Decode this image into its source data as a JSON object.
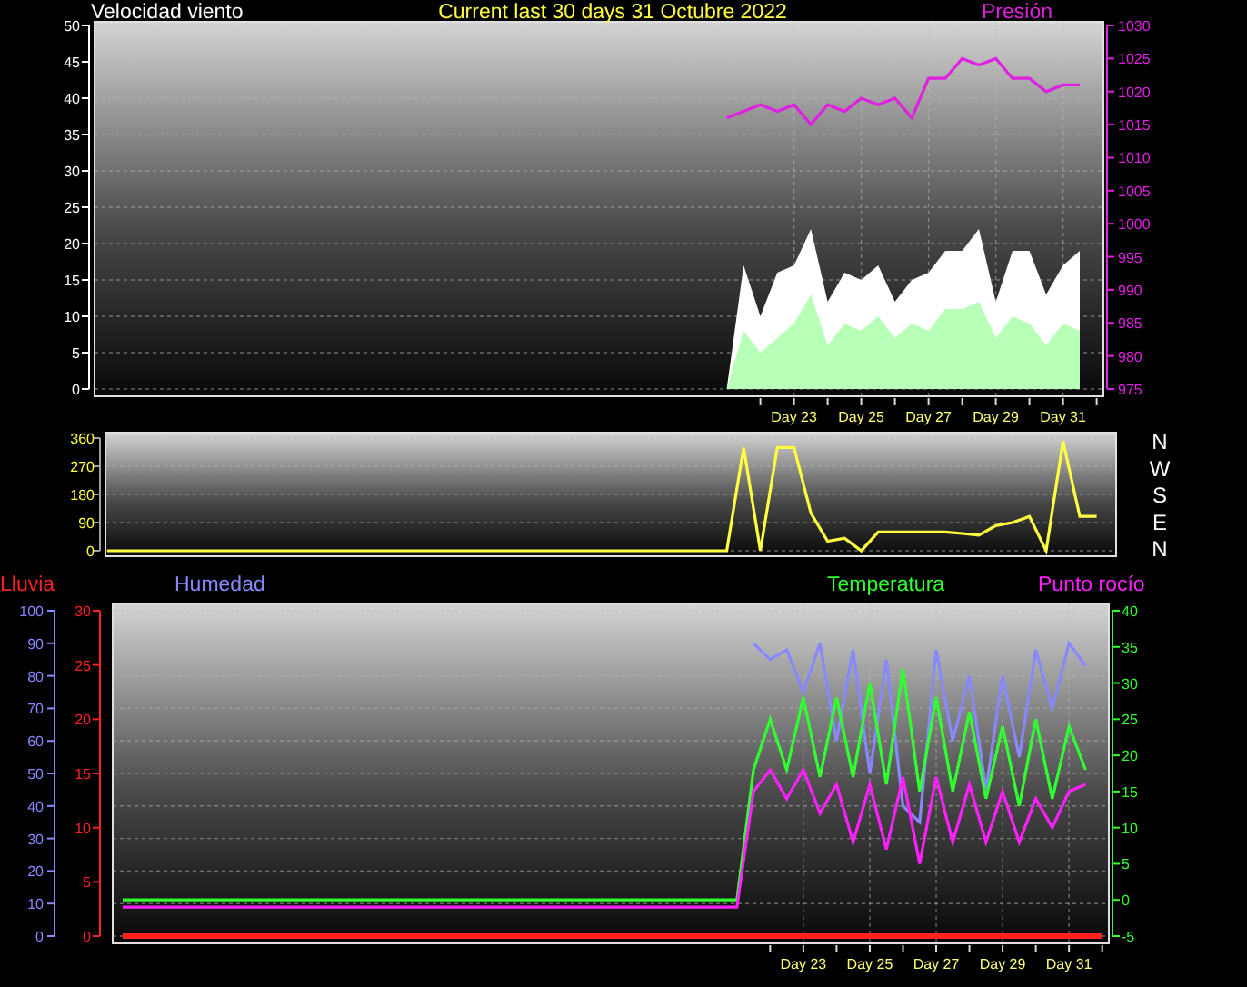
{
  "title": "Current last 30 days 31 Octubre 2022",
  "panels": [
    {
      "chart_data": {
        "type": "line",
        "categories": [
          null,
          null,
          null,
          null,
          null,
          null,
          null,
          null,
          null,
          null,
          null,
          null,
          null,
          null,
          null,
          null,
          null,
          null,
          null,
          null,
          null,
          null,
          null,
          null,
          null,
          null,
          null,
          null,
          null,
          null,
          null,
          null,
          null,
          null,
          null,
          null,
          null,
          null,
          null,
          null,
          null,
          "Day 23",
          null,
          null,
          null,
          "Day 25",
          null,
          null,
          null,
          "Day 27",
          null,
          null,
          null,
          "Day 29",
          null,
          null,
          null,
          "Day 31",
          null,
          null
        ],
        "grid": true,
        "ylim": [
          0,
          50
        ],
        "yticks": [
          0,
          5,
          10,
          15,
          20,
          25,
          30,
          35,
          40,
          45,
          50
        ],
        "y2lim": [
          975,
          1030
        ],
        "y2ticks": [
          975,
          980,
          985,
          990,
          995,
          1000,
          1005,
          1010,
          1015,
          1020,
          1025,
          1030
        ],
        "series": [
          {
            "name": "Velocidad viento",
            "type": "area",
            "color": "#ffffff",
            "values": [
              0,
              0,
              0,
              0,
              0,
              0,
              0,
              0,
              0,
              0,
              0,
              0,
              0,
              0,
              0,
              0,
              0,
              0,
              0,
              0,
              0,
              0,
              0,
              0,
              0,
              0,
              0,
              0,
              0,
              0,
              0,
              0,
              0,
              0,
              0,
              0,
              0,
              0,
              17,
              10,
              16,
              17,
              22,
              12,
              16,
              15,
              17,
              12,
              15,
              16,
              19,
              19,
              22,
              12,
              19,
              19,
              13,
              17,
              19,
              null
            ]
          },
          {
            "type": "area",
            "color": "#b8ffb8",
            "values": [
              0,
              0,
              0,
              0,
              0,
              0,
              0,
              0,
              0,
              0,
              0,
              0,
              0,
              0,
              0,
              0,
              0,
              0,
              0,
              0,
              0,
              0,
              0,
              0,
              0,
              0,
              0,
              0,
              0,
              0,
              0,
              0,
              0,
              0,
              0,
              0,
              0,
              0,
              8,
              5,
              7,
              9,
              13,
              6,
              9,
              8,
              10,
              7,
              9,
              8,
              11,
              11,
              12,
              7,
              10,
              9,
              6,
              9,
              8,
              null
            ]
          },
          {
            "name": "Presión",
            "type": "line",
            "axis": "y2",
            "color": "#e020e0",
            "values": [
              null,
              null,
              null,
              null,
              null,
              null,
              null,
              null,
              null,
              null,
              null,
              null,
              null,
              null,
              null,
              null,
              null,
              null,
              null,
              null,
              null,
              null,
              null,
              null,
              null,
              null,
              null,
              null,
              null,
              null,
              null,
              null,
              null,
              null,
              null,
              null,
              null,
              1016,
              1017,
              1018,
              1017,
              1018,
              1015,
              1018,
              1017,
              1019,
              1018,
              1019,
              1016,
              1022,
              1022,
              1025,
              1024,
              1025,
              1022,
              1022,
              1020,
              1021,
              1021,
              null
            ]
          }
        ]
      }
    },
    {
      "chart_data": {
        "type": "line",
        "categories": [
          null,
          null,
          null,
          null,
          null,
          null,
          null,
          null,
          null,
          null,
          null,
          null,
          null,
          null,
          null,
          null,
          null,
          null,
          null,
          null,
          null,
          null,
          null,
          null,
          null,
          null,
          null,
          null,
          null,
          null,
          null,
          null,
          null,
          null,
          null,
          null,
          null,
          null,
          null,
          null,
          null,
          null,
          null,
          null,
          null,
          null,
          null,
          null,
          null,
          null,
          null,
          null,
          null,
          null,
          null,
          null,
          null,
          null,
          null,
          null
        ],
        "ylim": [
          0,
          360
        ],
        "yticks": [
          0,
          90,
          180,
          270,
          360
        ],
        "grid": true,
        "series": [
          {
            "type": "line",
            "color": "#ffff40",
            "values": [
              0,
              0,
              0,
              0,
              0,
              0,
              0,
              0,
              0,
              0,
              0,
              0,
              0,
              0,
              0,
              0,
              0,
              0,
              0,
              0,
              0,
              0,
              0,
              0,
              0,
              0,
              0,
              0,
              0,
              0,
              0,
              0,
              0,
              0,
              0,
              0,
              0,
              0,
              330,
              0,
              330,
              330,
              120,
              30,
              40,
              0,
              60,
              60,
              60,
              60,
              60,
              55,
              50,
              80,
              90,
              110,
              0,
              350,
              110,
              110
            ]
          }
        ]
      },
      "compass_labels": [
        "N",
        "W",
        "S",
        "E",
        "N"
      ]
    },
    {
      "chart_data": {
        "type": "line",
        "categories": [
          null,
          null,
          null,
          null,
          null,
          null,
          null,
          null,
          null,
          null,
          null,
          null,
          null,
          null,
          null,
          null,
          null,
          null,
          null,
          null,
          null,
          null,
          null,
          null,
          null,
          null,
          null,
          null,
          null,
          null,
          null,
          null,
          null,
          null,
          null,
          null,
          null,
          null,
          null,
          null,
          null,
          "Day 23",
          null,
          null,
          null,
          "Day 25",
          null,
          null,
          null,
          "Day 27",
          null,
          null,
          null,
          "Day 29",
          null,
          null,
          null,
          "Day 31",
          null,
          null
        ],
        "grid": true,
        "ylim": [
          0,
          100
        ],
        "yticks": [
          0,
          10,
          20,
          30,
          40,
          50,
          60,
          70,
          80,
          90,
          100
        ],
        "y2lim": [
          0,
          30
        ],
        "y2ticks": [
          0,
          5,
          10,
          15,
          20,
          25,
          30
        ],
        "y3lim": [
          -5,
          40
        ],
        "y3ticks": [
          -5,
          0,
          5,
          10,
          15,
          20,
          25,
          30,
          35,
          40
        ],
        "series": [
          {
            "name": "Lluvia",
            "type": "line",
            "axis": "y2",
            "color": "#ff2020",
            "values": [
              0,
              0,
              0,
              0,
              0,
              0,
              0,
              0,
              0,
              0,
              0,
              0,
              0,
              0,
              0,
              0,
              0,
              0,
              0,
              0,
              0,
              0,
              0,
              0,
              0,
              0,
              0,
              0,
              0,
              0,
              0,
              0,
              0,
              0,
              0,
              0,
              0,
              0,
              0,
              0,
              0,
              0,
              0,
              0,
              0,
              0,
              0,
              0,
              0,
              0,
              0,
              0,
              0,
              0,
              0,
              0,
              0,
              0,
              0,
              0
            ]
          },
          {
            "name": "Humedad",
            "type": "line",
            "color": "#8888ff",
            "values": [
              null,
              null,
              null,
              null,
              null,
              null,
              null,
              null,
              null,
              null,
              null,
              null,
              null,
              null,
              null,
              null,
              null,
              null,
              null,
              null,
              null,
              null,
              null,
              null,
              null,
              null,
              null,
              null,
              null,
              null,
              null,
              null,
              null,
              null,
              null,
              null,
              null,
              null,
              90,
              85,
              88,
              75,
              90,
              60,
              88,
              50,
              85,
              40,
              35,
              88,
              60,
              80,
              45,
              80,
              55,
              88,
              70,
              90,
              83,
              null
            ]
          },
          {
            "name": "Temperatura",
            "type": "line",
            "axis": "y3",
            "color": "#30ff30",
            "values": [
              0,
              0,
              0,
              0,
              0,
              0,
              0,
              0,
              0,
              0,
              0,
              0,
              0,
              0,
              0,
              0,
              0,
              0,
              0,
              0,
              0,
              0,
              0,
              0,
              0,
              0,
              0,
              0,
              0,
              0,
              0,
              0,
              0,
              0,
              0,
              0,
              0,
              0,
              18,
              25,
              18,
              28,
              17,
              28,
              17,
              30,
              16,
              32,
              15,
              28,
              15,
              26,
              14,
              24,
              13,
              25,
              14,
              24,
              18,
              null
            ]
          },
          {
            "name": "Punto rocío",
            "type": "line",
            "axis": "y3",
            "color": "#ff20ff",
            "values": [
              -1,
              -1,
              -1,
              -1,
              -1,
              -1,
              -1,
              -1,
              -1,
              -1,
              -1,
              -1,
              -1,
              -1,
              -1,
              -1,
              -1,
              -1,
              -1,
              -1,
              -1,
              -1,
              -1,
              -1,
              -1,
              -1,
              -1,
              -1,
              -1,
              -1,
              -1,
              -1,
              -1,
              -1,
              -1,
              -1,
              -1,
              -1,
              15,
              18,
              14,
              18,
              12,
              16,
              8,
              16,
              7,
              17,
              5,
              17,
              8,
              16,
              8,
              15,
              8,
              14,
              10,
              15,
              16,
              null
            ]
          }
        ]
      }
    }
  ]
}
